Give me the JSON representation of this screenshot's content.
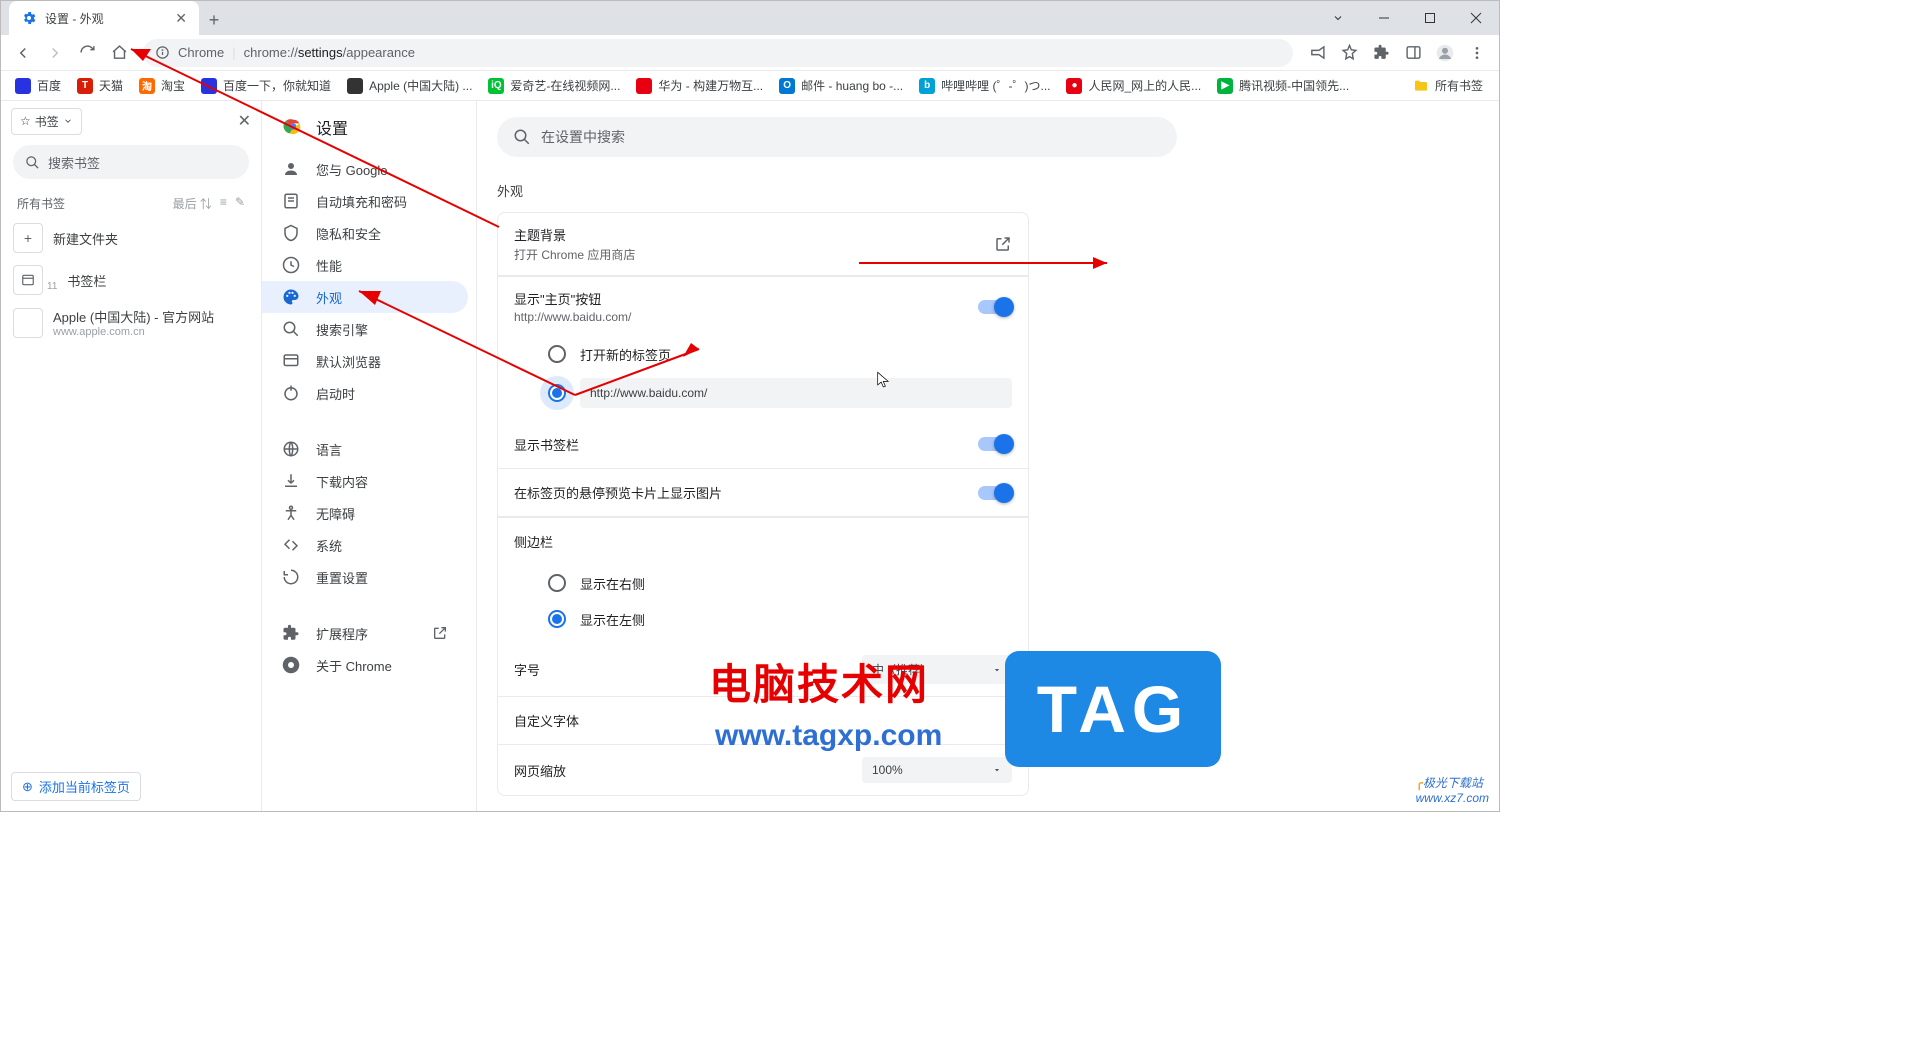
{
  "tab": {
    "title": "设置 - 外观"
  },
  "omnibox": {
    "prefix": "Chrome",
    "path_gray1": "chrome://",
    "path_dark": "settings",
    "path_gray2": "/appearance"
  },
  "bookmarks_bar": [
    {
      "label": "百度",
      "color": "#2932e1",
      "glyph": ""
    },
    {
      "label": "天猫",
      "color": "#d81e06",
      "glyph": "T"
    },
    {
      "label": "淘宝",
      "color": "#ff6a00",
      "glyph": "淘"
    },
    {
      "label": "百度一下，你就知道",
      "color": "#2932e1",
      "glyph": ""
    },
    {
      "label": "Apple (中国大陆) ...",
      "color": "#333",
      "glyph": ""
    },
    {
      "label": "爱奇艺-在线视频网...",
      "color": "#00c234",
      "glyph": "iQ"
    },
    {
      "label": "华为 - 构建万物互...",
      "color": "#e60012",
      "glyph": ""
    },
    {
      "label": "邮件 - huang bo -...",
      "color": "#0078d4",
      "glyph": "O"
    },
    {
      "label": "哔哩哔哩 (゜-゜)つ...",
      "color": "#00a1d6",
      "glyph": "b"
    },
    {
      "label": "人民网_网上的人民...",
      "color": "#e60012",
      "glyph": "●"
    },
    {
      "label": "腾讯视频-中国领先...",
      "color": "#ff6a00",
      "glyph": "▶"
    }
  ],
  "bookmarks_all": "所有书签",
  "bm_panel": {
    "dropdown": "书签",
    "search_placeholder": "搜索书签",
    "section": "所有书签",
    "sort_label": "最后",
    "new_folder": "新建文件夹",
    "bar_folder": "书签栏",
    "bar_count": "11",
    "apple_t": "Apple (中国大陆) - 官方网站",
    "apple_s": "www.apple.com.cn",
    "add_current": "添加当前标签页"
  },
  "settings": {
    "title": "设置",
    "search_placeholder": "在设置中搜索",
    "nav": {
      "you": "您与 Google",
      "autofill": "自动填充和密码",
      "privacy": "隐私和安全",
      "perf": "性能",
      "appearance": "外观",
      "search": "搜索引擎",
      "default": "默认浏览器",
      "startup": "启动时",
      "lang": "语言",
      "download": "下载内容",
      "a11y": "无障碍",
      "system": "系统",
      "reset": "重置设置",
      "ext": "扩展程序",
      "about": "关于 Chrome"
    },
    "appearance": {
      "header": "外观",
      "theme_t": "主题背景",
      "theme_s": "打开 Chrome 应用商店",
      "home_t": "显示\"主页\"按钮",
      "home_s": "http://www.baidu.com/",
      "radio_newtab": "打开新的标签页",
      "home_url": "http://www.baidu.com/",
      "show_bm": "显示书签栏",
      "hover_img": "在标签页的悬停预览卡片上显示图片",
      "sidebar_h": "侧边栏",
      "side_right": "显示在右侧",
      "side_left": "显示在左侧",
      "font_size": "字号",
      "font_size_val": "中（推荐）",
      "custom_font": "自定义字体",
      "zoom": "网页缩放",
      "zoom_val": "100%"
    }
  },
  "watermark": {
    "cn": "电脑技术网",
    "url": "www.tagxp.com",
    "tag": "TAG",
    "jg1": "极光下载站",
    "jg2": "www.xz7.com"
  }
}
